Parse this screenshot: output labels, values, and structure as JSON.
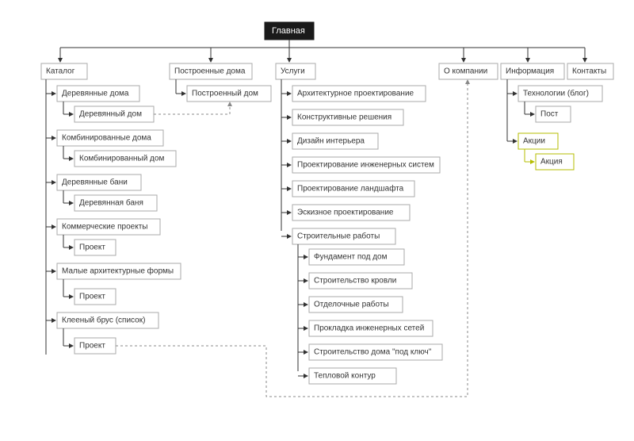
{
  "root": "Главная",
  "sections": {
    "catalog": {
      "title": "Каталог",
      "groups": [
        {
          "label": "Деревянные дома",
          "child": "Деревянный дом"
        },
        {
          "label": "Комбинированные дома",
          "child": "Комбинированный дом"
        },
        {
          "label": "Деревянные бани",
          "child": "Деревянная баня"
        },
        {
          "label": "Коммерческие проекты",
          "child": "Проект"
        },
        {
          "label": "Малые архитектурные формы",
          "child": "Проект"
        },
        {
          "label": "Клееный брус (список)",
          "child": "Проект"
        }
      ]
    },
    "built": {
      "title": "Построенные дома",
      "child": "Построенный дом"
    },
    "services": {
      "title": "Услуги",
      "items": [
        "Архитектурное проектирование",
        "Конструктивные решения",
        "Дизайн интерьера",
        "Проектирование инженерных систем",
        "Проектирование ландшафта",
        "Эскизное проектирование"
      ],
      "construction": {
        "title": "Строительные работы",
        "items": [
          "Фундамент под дом",
          "Строительство кровли",
          "Отделочные работы",
          "Прокладка инженерных сетей",
          "Строительство дома \"под ключ\"",
          "Тепловой контур"
        ]
      }
    },
    "about": {
      "title": "О компании"
    },
    "info": {
      "title": "Информация",
      "tech": {
        "label": "Технологии (блог)",
        "child": "Пост"
      },
      "promo": {
        "label": "Акции",
        "child": "Акция"
      }
    },
    "contacts": {
      "title": "Контакты"
    }
  }
}
